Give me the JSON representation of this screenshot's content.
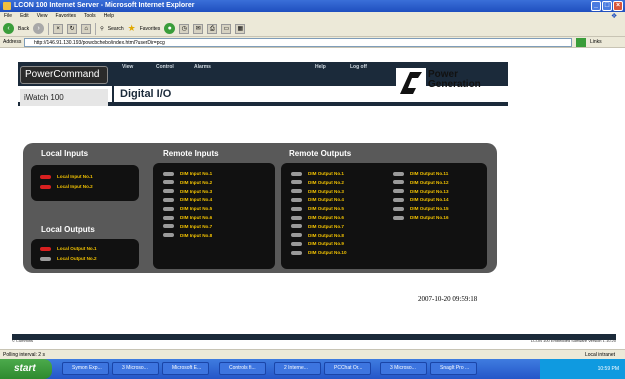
{
  "window": {
    "title": "LCON 100 Internet Server - Microsoft Internet Explorer",
    "min": "_",
    "max": "□",
    "close": "×"
  },
  "menu": [
    "File",
    "Edit",
    "View",
    "Favorites",
    "Tools",
    "Help"
  ],
  "toolbar": {
    "back": "Back",
    "search": "Search",
    "favorites": "Favorites"
  },
  "address": {
    "label": "Address",
    "url": "http://146.91.130.193/powcbchebo/index.html?userDir=pcg",
    "go": "Go",
    "links": "Links"
  },
  "header": {
    "logo": "PowerCommand",
    "product": "iWatch 100",
    "nav": [
      "View",
      "Control",
      "Alarms",
      "Help",
      "Log off"
    ],
    "page_title": "Digital I/O",
    "brand_line1": "Power",
    "brand_line2": "Generation"
  },
  "local_inputs": {
    "title": "Local Inputs",
    "items": [
      {
        "label": "Local Input No.1",
        "state": "red"
      },
      {
        "label": "Local Input No.2",
        "state": "red"
      }
    ]
  },
  "local_outputs": {
    "title": "Local Outputs",
    "items": [
      {
        "label": "Local Output No.1",
        "state": "red"
      },
      {
        "label": "Local Output No.2",
        "state": "gray"
      }
    ]
  },
  "remote_inputs": {
    "title": "Remote Inputs",
    "items": [
      "DIM Input No.1",
      "DIM Input No.2",
      "DIM Input No.3",
      "DIM Input No.4",
      "DIM Input No.5",
      "DIM Input No.6",
      "DIM Input No.7",
      "DIM Input No.8"
    ]
  },
  "remote_outputs": {
    "title": "Remote Outputs",
    "col1": [
      "DIM Output No.1",
      "DIM Output No.2",
      "DIM Output No.3",
      "DIM Output No.4",
      "DIM Output No.5",
      "DIM Output No.6",
      "DIM Output No.7",
      "DIM Output No.8",
      "DIM Output No.9",
      "DIM Output No.10"
    ],
    "col2": [
      "DIM Output No.11",
      "DIM Output No.12",
      "DIM Output No.13",
      "DIM Output No.14",
      "DIM Output No.15",
      "DIM Output No.16"
    ]
  },
  "timestamp": "2007-10-20 09:59:18",
  "footer": {
    "left": "© Cummins",
    "right": "LCON 100 Embedded Software Version 1.10.20"
  },
  "status": {
    "text": "Polling interval: 2 s",
    "zone": "Local intranet"
  },
  "taskbar": {
    "start": "start",
    "items": [
      "Symon Exp...",
      "3 Microso...",
      "Microsoft E...",
      "Controls fi...",
      "2 Interne...",
      "PCChat Or...",
      "3 Microso...",
      "SnagIt Pro ..."
    ],
    "clock": "10:59 PM"
  },
  "colors": {
    "led_on": "#d82020",
    "led_off": "#9a9a9a",
    "label": "#f2c200",
    "panel": "#595959",
    "navy": "#1b2a3a"
  }
}
